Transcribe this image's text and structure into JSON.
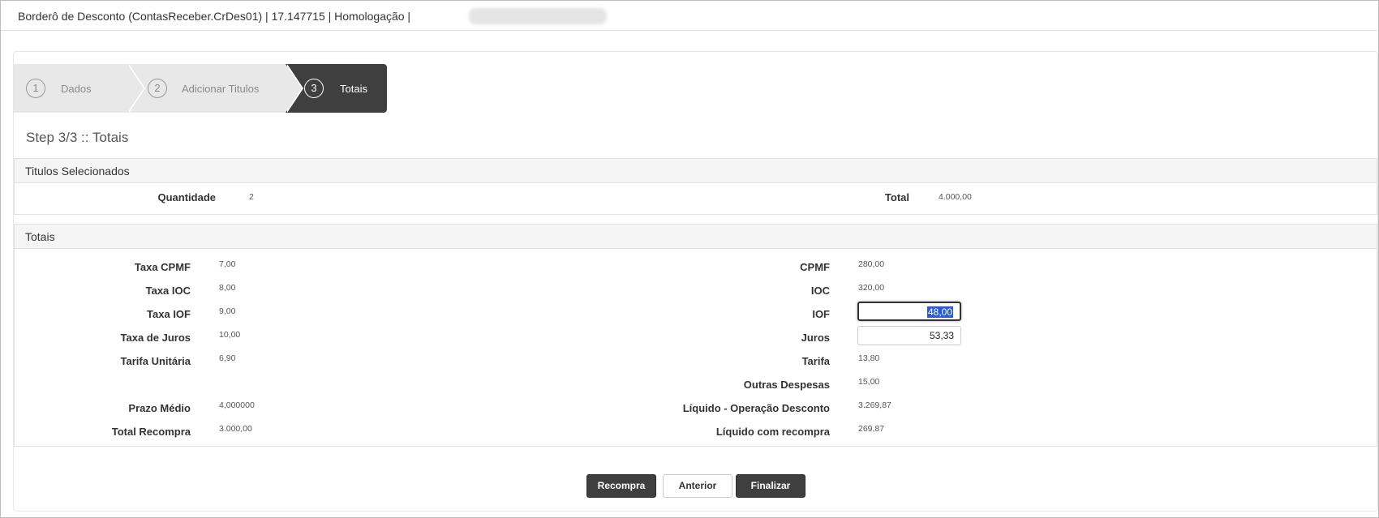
{
  "header": {
    "title": "Borderô de Desconto (ContasReceber.CrDes01) | 17.147715 | Homologação |"
  },
  "wizard": {
    "steps": [
      {
        "number": "1",
        "label": "Dados"
      },
      {
        "number": "2",
        "label": "Adicionar Titulos"
      },
      {
        "number": "3",
        "label": "Totais"
      }
    ],
    "active_step": 3,
    "heading": "Step 3/3 :: Totais"
  },
  "titulos": {
    "title": "Titulos Selecionados",
    "quantidade_label": "Quantidade",
    "quantidade_value": "2",
    "total_label": "Total",
    "total_value": "4.000,00"
  },
  "totais": {
    "title": "Totais",
    "left": [
      {
        "label": "Taxa CPMF",
        "value": "7,00"
      },
      {
        "label": "Taxa IOC",
        "value": "8,00"
      },
      {
        "label": "Taxa IOF",
        "value": "9,00"
      },
      {
        "label": "Taxa de Juros",
        "value": "10,00"
      },
      {
        "label": "Tarifa Unitária",
        "value": "6,90"
      },
      {
        "label": "Prazo Médio",
        "value": "4,000000"
      },
      {
        "label": "Total Recompra",
        "value": "3.000,00"
      }
    ],
    "right": [
      {
        "label": "CPMF",
        "value": "280,00"
      },
      {
        "label": "IOC",
        "value": "320,00"
      },
      {
        "label": "IOF",
        "value": "48,00"
      },
      {
        "label": "Juros",
        "value": "53,33"
      },
      {
        "label": "Tarifa",
        "value": "13,80"
      },
      {
        "label": "Outras Despesas",
        "value": "15,00"
      },
      {
        "label": "Líquido - Operação Desconto",
        "value": "3.269,87"
      },
      {
        "label": "Líquido com recompra",
        "value": "269,87"
      }
    ]
  },
  "buttons": {
    "recompra": "Recompra",
    "anterior": "Anterior",
    "finalizar": "Finalizar"
  },
  "colors": {
    "accent_dark": "#3f3f3f",
    "step_inactive": "#e8e8e8",
    "selection": "#2a5bd7"
  }
}
